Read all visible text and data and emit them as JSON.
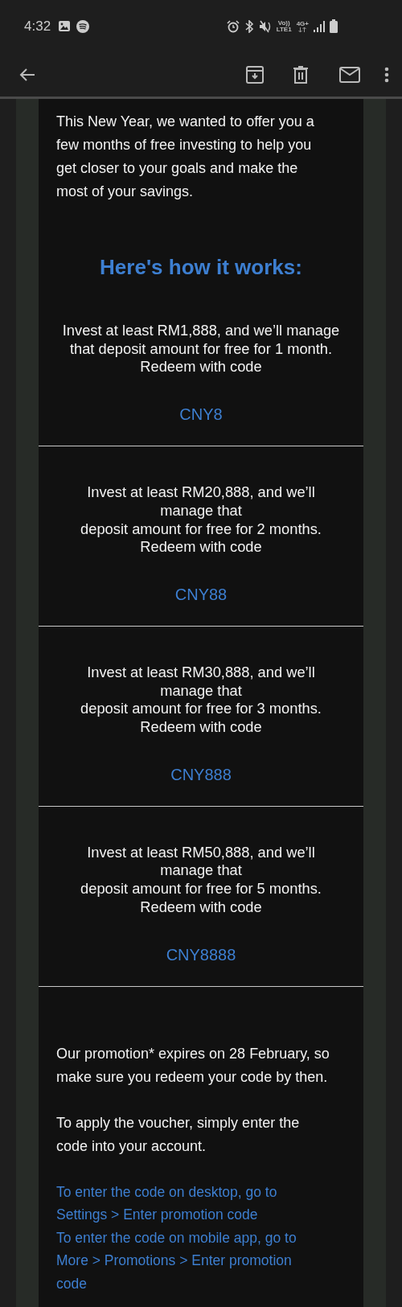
{
  "status_bar": {
    "time": "4:32",
    "voice_label": "Vo))",
    "lte_label": "LTE1",
    "network_label": "4G+"
  },
  "toolbar": {
    "actions": [
      {
        "kind": "archive"
      },
      {
        "kind": "delete"
      },
      {
        "kind": "mark_unread"
      },
      {
        "kind": "more"
      }
    ]
  },
  "email": {
    "intro": "This New Year, we wanted to offer you a few months of free investing to help you get closer to your goals and make the most of your savings.",
    "heading": "Here's how it works:",
    "offers": [
      {
        "text": "Invest at least RM1,888, and we’ll manage\nthat deposit amount for free for 1 month.\nRedeem with code",
        "code": "CNY8"
      },
      {
        "text": "Invest at least RM20,888, and we’ll\nmanage that\ndeposit amount for free for 2 months.\nRedeem with code",
        "code": "CNY88"
      },
      {
        "text": "Invest at least RM30,888, and we’ll\nmanage that\ndeposit amount for free for 3 months.\nRedeem with code",
        "code": "CNY888"
      },
      {
        "text": "Invest at least RM50,888, and we’ll\nmanage that\ndeposit amount for free for 5 months.\nRedeem with code",
        "code": "CNY8888"
      }
    ],
    "paragraphs": [
      "Our promotion* expires on 28 February, so make sure you redeem your code by then.",
      "To apply the voucher, simply enter the code into your account."
    ],
    "links": [
      "To enter the code on desktop, go to Settings > Enter promotion code",
      "To enter the code on mobile app, go to More > Promotions > Enter promotion code"
    ]
  }
}
